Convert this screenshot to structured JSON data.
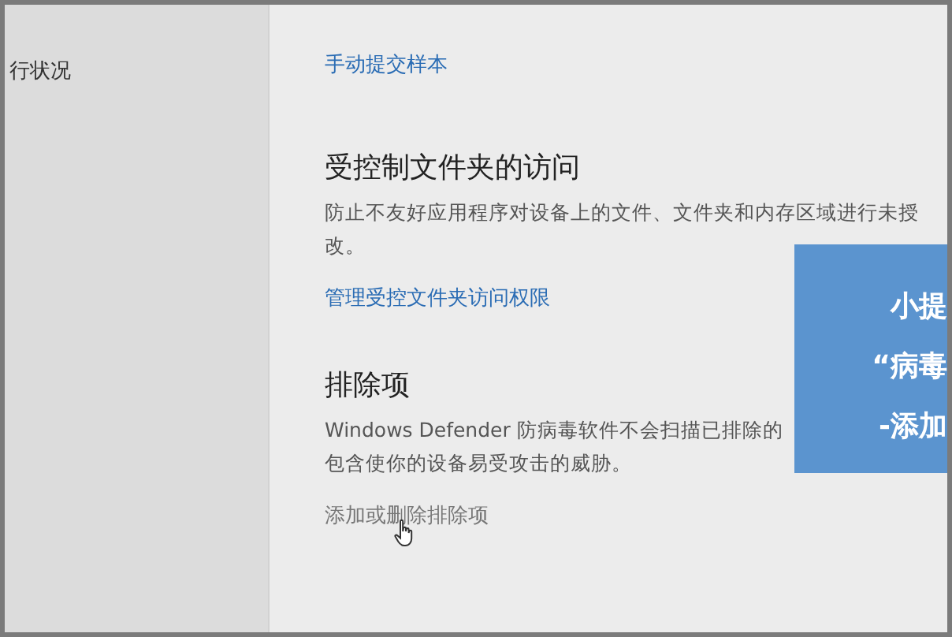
{
  "sidebar": {
    "item": "行状况"
  },
  "sections": [
    {
      "link": "手动提交样本",
      "kind": "blue"
    },
    {
      "heading": "受控制文件夹的访问",
      "lines": [
        "防止不友好应用程序对设备上的文件、文件夹和内存区域进行未授",
        "改。"
      ],
      "link": "管理受控文件夹访问权限",
      "kind": "blue"
    },
    {
      "heading": "排除项",
      "lines": [
        "Windows Defender 防病毒软件不会扫描已排除的",
        "包含使你的设备易受攻击的威胁。"
      ],
      "link": "添加或删除排除项",
      "kind": "hover"
    }
  ],
  "overlay": {
    "lines": [
      "小提",
      "“病毒",
      "-添加"
    ]
  }
}
